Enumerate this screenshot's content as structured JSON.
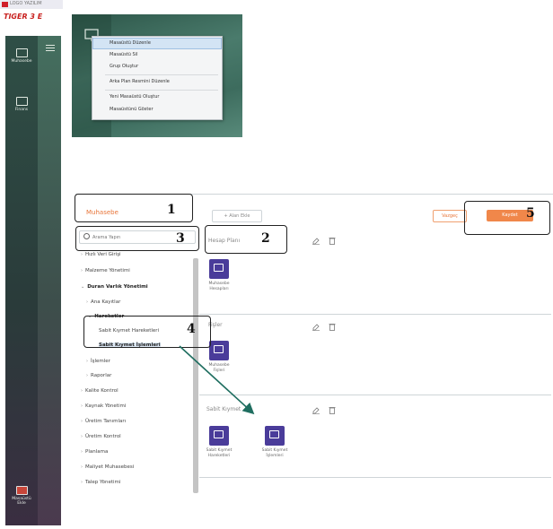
{
  "brand": {
    "company": "LOGO YAZILIM",
    "product": "TIGER 3 E"
  },
  "nav_rail": {
    "items": [
      {
        "label": "Muhasebe",
        "icon": "monitor-icon"
      },
      {
        "label": "Finans",
        "icon": "monitor-icon"
      }
    ],
    "bottom_item": {
      "label": "Masaüstü\nEkle",
      "icon": "add-desktop-icon"
    }
  },
  "context_menu": {
    "items": [
      {
        "label": "Masaüstü Düzenle",
        "highlighted": true
      },
      {
        "label": "Masaüstü Sil",
        "highlighted": false
      },
      {
        "label": "Grup Oluştur",
        "highlighted": false
      },
      {
        "label": "Arka Plan Resmini Düzenle",
        "highlighted": false
      },
      {
        "label": "Yeni Masaüstü Oluştur",
        "highlighted": false
      },
      {
        "label": "Masaüstünü Göster",
        "highlighted": false
      }
    ]
  },
  "page": {
    "title": "Muhasebe",
    "add_page_label": "+ Alan Ekle",
    "cancel_label": "Vazgeç",
    "save_label": "Kaydet"
  },
  "search": {
    "placeholder": "Arama Yapın",
    "value": ""
  },
  "tree": {
    "items": [
      {
        "label": "Hızlı Veri Girişi",
        "chevron": true,
        "bold": false
      },
      {
        "label": "Malzeme Yönetimi",
        "chevron": true,
        "bold": false
      },
      {
        "label": "Duran Varlık Yönetimi",
        "chevron": true,
        "bold": true
      },
      {
        "label": "Ana Kayıtlar",
        "chevron": true,
        "bold": false
      },
      {
        "label": "Hareketler",
        "chevron": true,
        "bold": true
      },
      {
        "label": "Sabit Kıymet Hareketleri",
        "chevron": false,
        "bold": false
      },
      {
        "label": "Sabit Kıymet İşlemleri",
        "chevron": false,
        "bold": true
      },
      {
        "label": "İşlemler",
        "chevron": true,
        "bold": false
      },
      {
        "label": "Raporlar",
        "chevron": true,
        "bold": false
      },
      {
        "label": "Kalite Kontrol",
        "chevron": true,
        "bold": false
      },
      {
        "label": "Kaynak Yönetimi",
        "chevron": true,
        "bold": false
      },
      {
        "label": "Üretim Tanımları",
        "chevron": true,
        "bold": false
      },
      {
        "label": "Üretim Kontrol",
        "chevron": true,
        "bold": false
      },
      {
        "label": "Planlama",
        "chevron": true,
        "bold": false
      },
      {
        "label": "Maliyet Muhasebesi",
        "chevron": true,
        "bold": false
      },
      {
        "label": "Talep Yönetimi",
        "chevron": true,
        "bold": false
      }
    ]
  },
  "sections": [
    {
      "title": "Hesap Planı",
      "tiles": [
        {
          "label": "Muhasebe\nHesapları",
          "icon": "account-card-icon"
        }
      ]
    },
    {
      "title": "Fişler",
      "tiles": [
        {
          "label": "Muhasebe\nFişleri",
          "icon": "voucher-icon"
        }
      ]
    },
    {
      "title": "Sabit Kıymet",
      "tiles": [
        {
          "label": "Sabit Kıymet\nHareketleri",
          "icon": "fixed-asset-movements-icon"
        },
        {
          "label": "Sabit Kıymet\nİşlemleri",
          "icon": "fixed-asset-operations-icon"
        }
      ]
    }
  ],
  "callouts": [
    "1",
    "2",
    "3",
    "4",
    "5"
  ],
  "colors": {
    "accent": "#f0874a",
    "title": "#e8763a",
    "tile": "#4a3c9a",
    "rail": "#2f4f46",
    "arrow": "#1f6e60"
  }
}
